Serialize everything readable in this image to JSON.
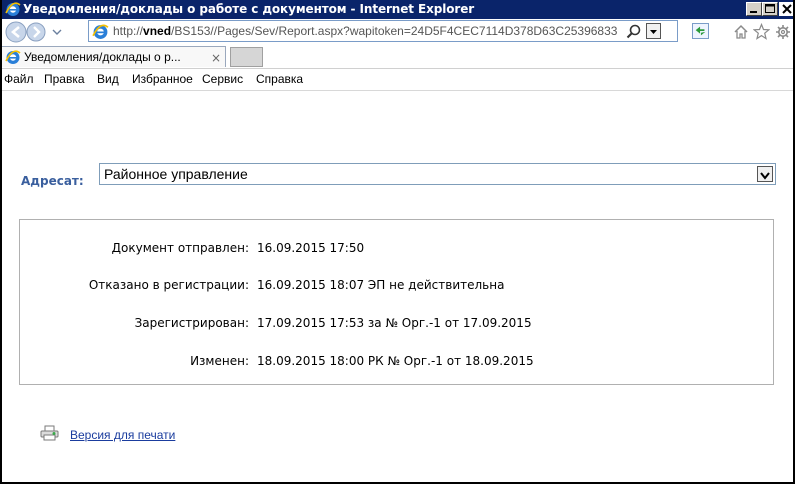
{
  "window": {
    "title": "Уведомления/доклады о работе с документом - Internet Explorer"
  },
  "addressbar": {
    "url_prefix": "http://",
    "url_host": "vned",
    "url_rest": "/BS153//Pages/Sev/Report.aspx?wapitoken=24D5F4CEC7114D378D63C25396833"
  },
  "tab": {
    "label": "Уведомления/доклады о р...",
    "close_glyph": "×"
  },
  "menu": {
    "items": [
      "Файл",
      "Правка",
      "Вид",
      "Избранное",
      "Сервис",
      "Справка"
    ]
  },
  "addressee": {
    "label": "Адресат:",
    "selected": "Районное управление"
  },
  "report": {
    "rows": [
      {
        "label": "Документ отправлен:",
        "value": "16.09.2015 17:50"
      },
      {
        "label": "Отказано в регистрации:",
        "value": "16.09.2015 18:07 ЭП не действительна"
      },
      {
        "label": "Зарегистрирован:",
        "value": "17.09.2015 17:53 за № Орг.-1 от 17.09.2015"
      },
      {
        "label": "Изменен:",
        "value": "18.09.2015 18:00 РК № Орг.-1 от 18.09.2015"
      }
    ]
  },
  "print": {
    "link_text": "Версия для печати"
  },
  "colors": {
    "titlebar": "#0a246a",
    "label_blue": "#3a5f9e",
    "link_blue": "#1a3c9e"
  }
}
